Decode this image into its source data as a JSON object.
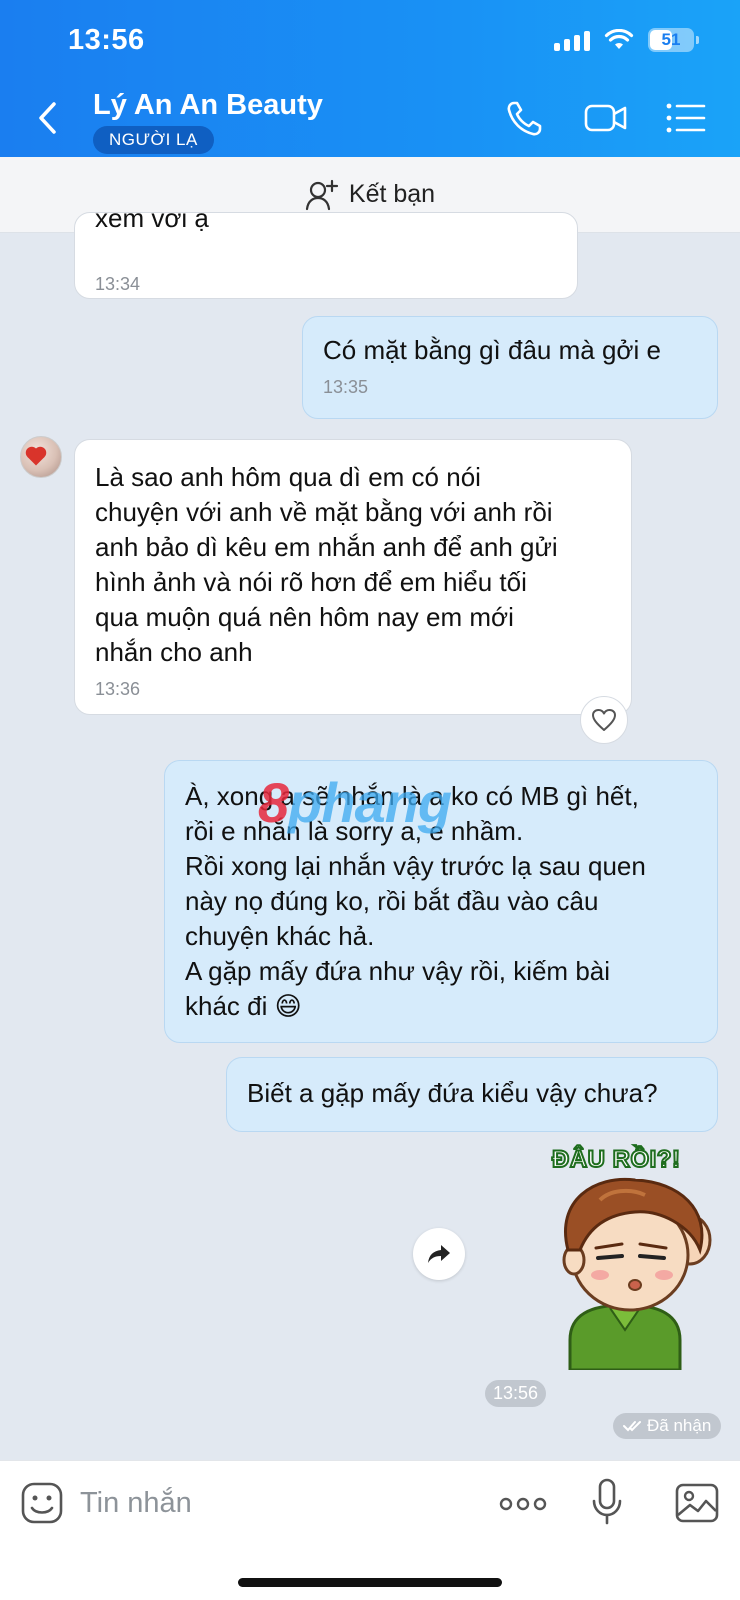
{
  "status_bar": {
    "time": "13:56",
    "battery": "51"
  },
  "header": {
    "contact_name": "Lý An An Beauty",
    "badge": "NGƯỜI LẠ"
  },
  "friend_bar": {
    "label": "Kết bạn"
  },
  "messages": [
    {
      "side": "in",
      "text": "xem với ạ",
      "time": "13:34"
    },
    {
      "side": "out",
      "text": "Có mặt bằng gì đâu mà gởi e",
      "time": "13:35"
    },
    {
      "side": "in",
      "text": "Là sao anh hôm qua dì em có nói\nchuyện với anh về mặt bằng với anh rồi\nanh bảo dì kêu em nhắn anh để anh gửi\nhình ảnh và nói rõ hơn để em hiểu tối\nqua muộn quá nên hôm nay em mới\nnhắn cho anh",
      "time": "13:36"
    },
    {
      "side": "out",
      "text": "À, xong a sẽ nhắn là a ko có MB gì hết,\nrồi e nhắn là sorry a, e nhầm.\nRồi xong lại nhắn vậy trước lạ sau quen\nnày nọ đúng ko, rồi bắt đầu vào câu\nchuyện khác hả.\nA gặp mấy đứa như vậy rồi, kiếm bài\nkhác đi 😄"
    },
    {
      "side": "out",
      "text": "Biết a gặp mấy đứa kiểu vậy chưa?"
    }
  ],
  "watermark": {
    "part1": "8",
    "part2": "phang"
  },
  "sticker": {
    "caption": "ĐÂU RỒI?!"
  },
  "last_time": "13:56",
  "received_status": "Đã nhận",
  "composer": {
    "placeholder": "Tin nhắn"
  },
  "colors": {
    "header_blue": "#1a7ef0",
    "out_bubble": "#d6ebfb",
    "in_bubble": "#ffffff",
    "chat_bg": "#e2e8f0"
  }
}
